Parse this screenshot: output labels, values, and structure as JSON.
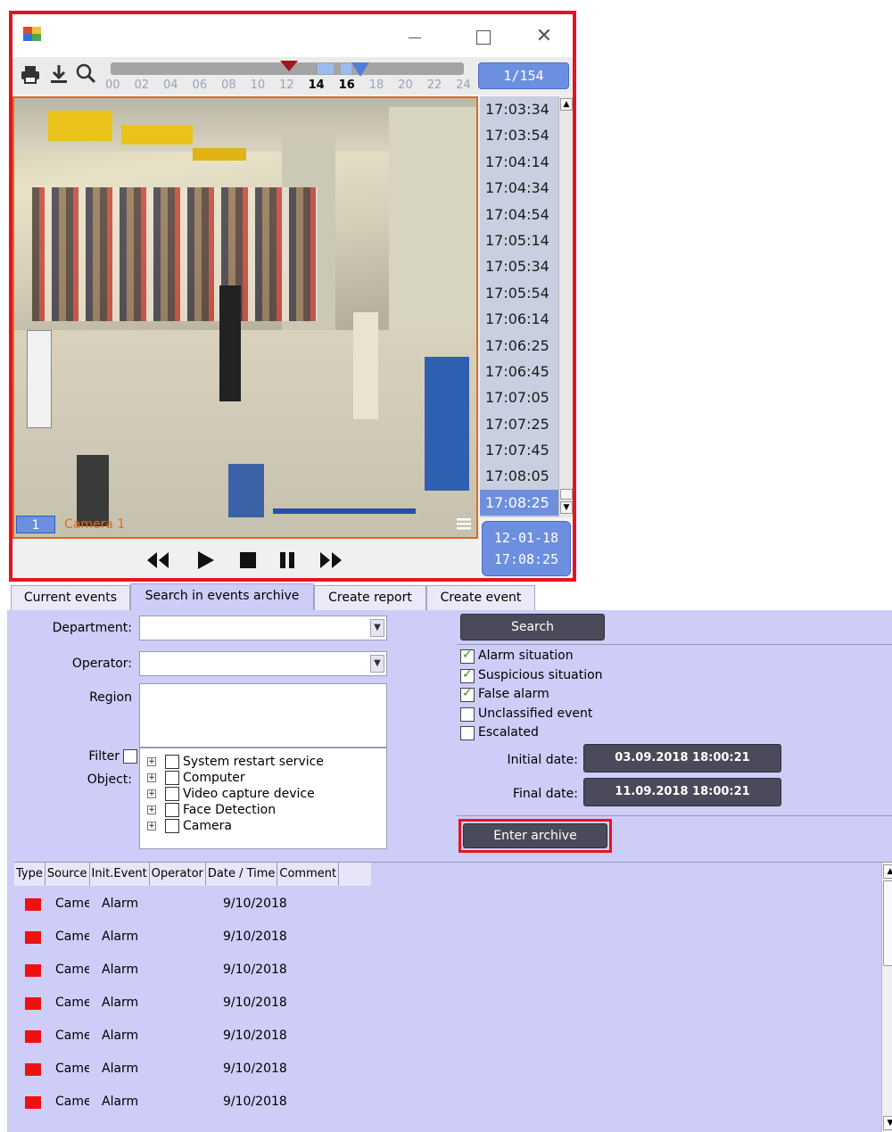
{
  "video_window": {
    "page_counter": "1/154",
    "timeline_labels": [
      "00",
      "02",
      "04",
      "06",
      "08",
      "10",
      "12",
      "14",
      "16",
      "18",
      "20",
      "22",
      "24"
    ],
    "timeline_bold": [
      "14",
      "16"
    ],
    "time_list": [
      "17:03:34",
      "17:03:54",
      "17:04:14",
      "17:04:34",
      "17:04:54",
      "17:05:14",
      "17:05:34",
      "17:05:54",
      "17:06:14",
      "17:06:25",
      "17:06:45",
      "17:07:05",
      "17:07:25",
      "17:07:45",
      "17:08:05",
      "17:08:25"
    ],
    "selected_time": "17:08:25",
    "camera_number": "1",
    "camera_name": "Camera 1",
    "date": "12-01-18",
    "time": "17:08:25"
  },
  "tabs": [
    {
      "label": "Current events",
      "active": false
    },
    {
      "label": "Search in events archive",
      "active": true
    },
    {
      "label": "Create report",
      "active": false
    },
    {
      "label": "Create event",
      "active": false
    }
  ],
  "form": {
    "department_label": "Department:",
    "operator_label": "Operator:",
    "region_label": "Region",
    "filter_label": "Filter",
    "object_label": "Object:",
    "objects": [
      "System restart service",
      "Computer",
      "Video capture device",
      "Face Detection",
      "Camera"
    ],
    "search_button": "Search",
    "event_types": [
      {
        "label": "Alarm situation",
        "checked": true
      },
      {
        "label": "Suspicious situation",
        "checked": true
      },
      {
        "label": "False alarm",
        "checked": true
      },
      {
        "label": "Unclassified event",
        "checked": false
      },
      {
        "label": "Escalated",
        "checked": false
      }
    ],
    "initial_date_label": "Initial date:",
    "initial_date": "03.09.2018 18:00:21",
    "final_date_label": "Final date:",
    "final_date": "11.09.2018 18:00:21",
    "enter_archive_button": "Enter archive"
  },
  "table": {
    "columns": [
      "Type",
      "Source",
      "Init.Event",
      "Operator",
      "Date / Time",
      "Comment"
    ],
    "rows": [
      {
        "source": "Camera",
        "event": "Alarm",
        "date": "9/10/2018",
        "color": "#ef1111"
      },
      {
        "source": "Camera",
        "event": "Alarm",
        "date": "9/10/2018",
        "color": "#ef1111"
      },
      {
        "source": "Camera",
        "event": "Alarm",
        "date": "9/10/2018",
        "color": "#ef1111"
      },
      {
        "source": "Camera",
        "event": "Alarm",
        "date": "9/10/2018",
        "color": "#ef1111"
      },
      {
        "source": "Camera",
        "event": "Alarm",
        "date": "9/10/2018",
        "color": "#ef1111"
      },
      {
        "source": "Camera",
        "event": "Alarm",
        "date": "9/10/2018",
        "color": "#ef1111"
      },
      {
        "source": "Camera",
        "event": "Alarm",
        "date": "9/10/2018",
        "color": "#ef1111"
      }
    ]
  },
  "colors": {
    "highlight": "#e8131f",
    "accent_blue": "#6d8fe0",
    "panel_bg": "#cdcdf8",
    "dark_button": "#4a4a5a"
  }
}
